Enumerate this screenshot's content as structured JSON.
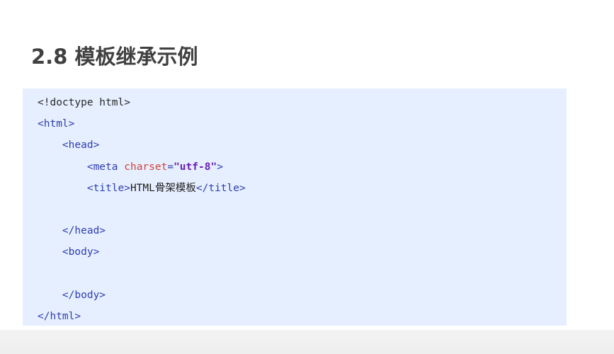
{
  "slide": {
    "title": "2.8 模板继承示例"
  },
  "code": {
    "doctype": "<!doctype html>",
    "html_open": "<html>",
    "head_open": "<head>",
    "meta_open": "<meta ",
    "meta_attr": "charset",
    "meta_eq": "=",
    "meta_value": "\"utf-8\"",
    "meta_close": ">",
    "title_open": "<title>",
    "title_text": "HTML骨架模板",
    "title_close": "</title>",
    "head_close": "</head>",
    "body_open": "<body>",
    "body_close": "</body>",
    "html_close": "</html>"
  },
  "colors": {
    "code_background": "#e6efff",
    "tag": "#2f3db0",
    "attribute": "#d0433a",
    "string": "#6a1fb5",
    "title": "#404040"
  }
}
